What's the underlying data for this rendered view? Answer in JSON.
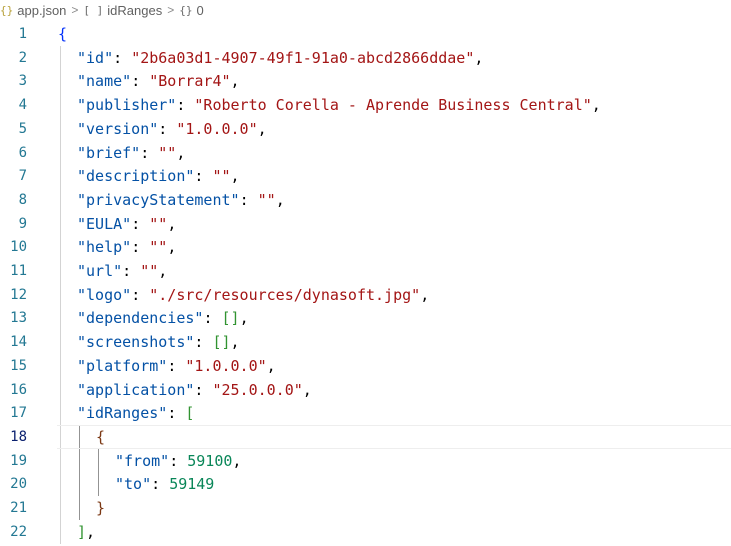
{
  "breadcrumb": {
    "file_icon": "{}",
    "file": "app.json",
    "array_icon": "[ ]",
    "array": "idRanges",
    "object_icon": "{}",
    "object": "0",
    "separator": ">"
  },
  "editor": {
    "current_line": 18,
    "lines": [
      {
        "num": "1",
        "indent": 0,
        "tokens": [
          {
            "t": "{",
            "c": "b1"
          }
        ]
      },
      {
        "num": "2",
        "indent": 1,
        "tokens": [
          {
            "t": "\"id\"",
            "c": "k"
          },
          {
            "t": ": ",
            "c": "p"
          },
          {
            "t": "\"2b6a03d1-4907-49f1-91a0-abcd2866ddae\"",
            "c": "s"
          },
          {
            "t": ",",
            "c": "p"
          }
        ]
      },
      {
        "num": "3",
        "indent": 1,
        "tokens": [
          {
            "t": "\"name\"",
            "c": "k"
          },
          {
            "t": ": ",
            "c": "p"
          },
          {
            "t": "\"Borrar4\"",
            "c": "s"
          },
          {
            "t": ",",
            "c": "p"
          }
        ]
      },
      {
        "num": "4",
        "indent": 1,
        "tokens": [
          {
            "t": "\"publisher\"",
            "c": "k"
          },
          {
            "t": ": ",
            "c": "p"
          },
          {
            "t": "\"Roberto Corella - Aprende Business Central\"",
            "c": "s"
          },
          {
            "t": ",",
            "c": "p"
          }
        ]
      },
      {
        "num": "5",
        "indent": 1,
        "tokens": [
          {
            "t": "\"version\"",
            "c": "k"
          },
          {
            "t": ": ",
            "c": "p"
          },
          {
            "t": "\"1.0.0.0\"",
            "c": "s"
          },
          {
            "t": ",",
            "c": "p"
          }
        ]
      },
      {
        "num": "6",
        "indent": 1,
        "tokens": [
          {
            "t": "\"brief\"",
            "c": "k"
          },
          {
            "t": ": ",
            "c": "p"
          },
          {
            "t": "\"\"",
            "c": "s"
          },
          {
            "t": ",",
            "c": "p"
          }
        ]
      },
      {
        "num": "7",
        "indent": 1,
        "tokens": [
          {
            "t": "\"description\"",
            "c": "k"
          },
          {
            "t": ": ",
            "c": "p"
          },
          {
            "t": "\"\"",
            "c": "s"
          },
          {
            "t": ",",
            "c": "p"
          }
        ]
      },
      {
        "num": "8",
        "indent": 1,
        "tokens": [
          {
            "t": "\"privacyStatement\"",
            "c": "k"
          },
          {
            "t": ": ",
            "c": "p"
          },
          {
            "t": "\"\"",
            "c": "s"
          },
          {
            "t": ",",
            "c": "p"
          }
        ]
      },
      {
        "num": "9",
        "indent": 1,
        "tokens": [
          {
            "t": "\"EULA\"",
            "c": "k"
          },
          {
            "t": ": ",
            "c": "p"
          },
          {
            "t": "\"\"",
            "c": "s"
          },
          {
            "t": ",",
            "c": "p"
          }
        ]
      },
      {
        "num": "10",
        "indent": 1,
        "tokens": [
          {
            "t": "\"help\"",
            "c": "k"
          },
          {
            "t": ": ",
            "c": "p"
          },
          {
            "t": "\"\"",
            "c": "s"
          },
          {
            "t": ",",
            "c": "p"
          }
        ]
      },
      {
        "num": "11",
        "indent": 1,
        "tokens": [
          {
            "t": "\"url\"",
            "c": "k"
          },
          {
            "t": ": ",
            "c": "p"
          },
          {
            "t": "\"\"",
            "c": "s"
          },
          {
            "t": ",",
            "c": "p"
          }
        ]
      },
      {
        "num": "12",
        "indent": 1,
        "tokens": [
          {
            "t": "\"logo\"",
            "c": "k"
          },
          {
            "t": ": ",
            "c": "p"
          },
          {
            "t": "\"./src/resources/dynasoft.jpg\"",
            "c": "s"
          },
          {
            "t": ",",
            "c": "p"
          }
        ]
      },
      {
        "num": "13",
        "indent": 1,
        "tokens": [
          {
            "t": "\"dependencies\"",
            "c": "k"
          },
          {
            "t": ": ",
            "c": "p"
          },
          {
            "t": "[]",
            "c": "b2"
          },
          {
            "t": ",",
            "c": "p"
          }
        ]
      },
      {
        "num": "14",
        "indent": 1,
        "tokens": [
          {
            "t": "\"screenshots\"",
            "c": "k"
          },
          {
            "t": ": ",
            "c": "p"
          },
          {
            "t": "[]",
            "c": "b2"
          },
          {
            "t": ",",
            "c": "p"
          }
        ]
      },
      {
        "num": "15",
        "indent": 1,
        "tokens": [
          {
            "t": "\"platform\"",
            "c": "k"
          },
          {
            "t": ": ",
            "c": "p"
          },
          {
            "t": "\"1.0.0.0\"",
            "c": "s"
          },
          {
            "t": ",",
            "c": "p"
          }
        ]
      },
      {
        "num": "16",
        "indent": 1,
        "tokens": [
          {
            "t": "\"application\"",
            "c": "k"
          },
          {
            "t": ": ",
            "c": "p"
          },
          {
            "t": "\"25.0.0.0\"",
            "c": "s"
          },
          {
            "t": ",",
            "c": "p"
          }
        ]
      },
      {
        "num": "17",
        "indent": 1,
        "tokens": [
          {
            "t": "\"idRanges\"",
            "c": "k"
          },
          {
            "t": ": ",
            "c": "p"
          },
          {
            "t": "[",
            "c": "b2"
          }
        ]
      },
      {
        "num": "18",
        "indent": 2,
        "tokens": [
          {
            "t": "{",
            "c": "b3"
          }
        ]
      },
      {
        "num": "19",
        "indent": 3,
        "tokens": [
          {
            "t": "\"from\"",
            "c": "k"
          },
          {
            "t": ": ",
            "c": "p"
          },
          {
            "t": "59100",
            "c": "n"
          },
          {
            "t": ",",
            "c": "p"
          }
        ]
      },
      {
        "num": "20",
        "indent": 3,
        "tokens": [
          {
            "t": "\"to\"",
            "c": "k"
          },
          {
            "t": ": ",
            "c": "p"
          },
          {
            "t": "59149",
            "c": "n"
          }
        ]
      },
      {
        "num": "21",
        "indent": 2,
        "tokens": [
          {
            "t": "}",
            "c": "b3"
          }
        ]
      },
      {
        "num": "22",
        "indent": 1,
        "tokens": [
          {
            "t": "]",
            "c": "b2"
          },
          {
            "t": ",",
            "c": "p"
          }
        ]
      }
    ]
  }
}
